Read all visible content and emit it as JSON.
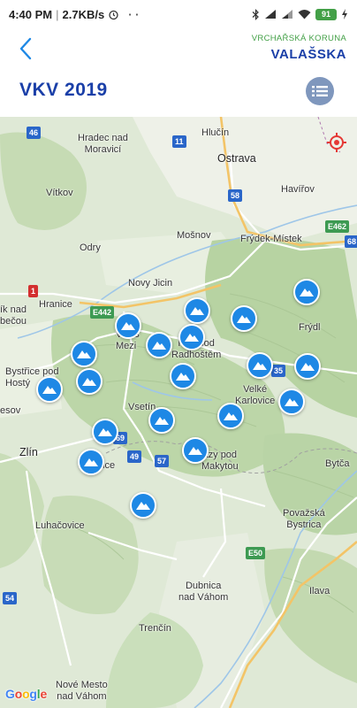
{
  "status_bar": {
    "time": "4:40 PM",
    "speed": "2.7KB/s",
    "dots": "· ·",
    "battery": "91",
    "icons": [
      "alarm-icon",
      "bluetooth-icon",
      "signal-icon",
      "signal-icon",
      "wifi-icon",
      "battery-icon",
      "charging-icon"
    ]
  },
  "header": {
    "back_icon": "chevron-left-icon",
    "region_subtitle": "VRCHAŘSKÁ KORUNA",
    "region_name": "VALAŠSKA",
    "title": "VKV 2019",
    "list_icon": "list-icon"
  },
  "colors": {
    "brand_blue": "#1a3fa8",
    "accent_green": "#43a047",
    "marker_blue": "#1e88e5",
    "list_button": "#7f97bd"
  },
  "map": {
    "places": {
      "hradec": "Hradec nad\nMoravicí",
      "hlucin": "Hlučín",
      "ostrava": "Ostrava",
      "vitkov": "Vítkov",
      "havirov": "Havířov",
      "mosnov": "Mošnov",
      "frydek": "Frýdek-Místek",
      "odry": "Odry",
      "novy_jicin": "Novy Jicin",
      "hranice": "Hranice",
      "lipnik": "ík nad\nbečou",
      "valasske_mezirici": "Valaš\nMezi",
      "roznov": "R     pod\nRadhoštěm",
      "bystrice": "Bystřice pod\nHostý",
      "holesov": "esov",
      "vsetin": "Vsetín",
      "velke_karlovice": "Velké\nKarlovice",
      "zlin": "Zlín",
      "vizovice": "ice",
      "vsemina_end": "azy pod\nMakytou",
      "bytca": "Bytča",
      "luhacovice": "Luhačovice",
      "povazska": "Považská\nBystrica",
      "dubnica": "Dubnica\nnad Váhom",
      "ilava": "Ilava",
      "trencin": "Trenčín",
      "nove_mesto": "Nové Mesto\nnad Váhom",
      "frydlant": "Frýdl"
    },
    "road_shields": {
      "r46": "46",
      "r11": "11",
      "r58": "58",
      "e462": "E462",
      "r68": "68",
      "e442": "E442",
      "r1": "1",
      "r35": "35",
      "r49": "49",
      "r57": "57",
      "r69": "69",
      "e50": "E50",
      "r54": "54"
    },
    "markers_count": 22,
    "marker_icon": "mountain-icon",
    "locate_icon": "target-icon",
    "google_logo": "Google"
  }
}
